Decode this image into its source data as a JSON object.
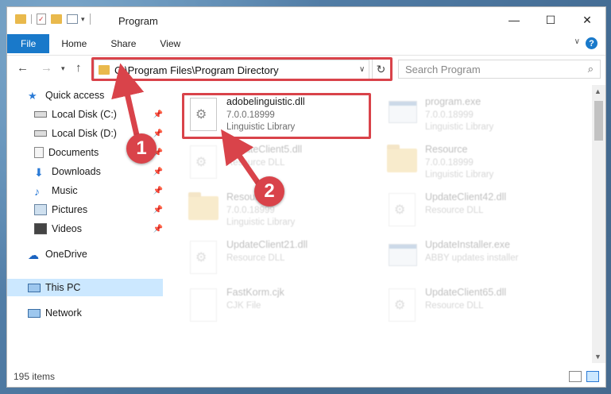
{
  "window": {
    "title": "Program",
    "minimize_glyph": "—",
    "maximize_glyph": "☐",
    "close_glyph": "✕"
  },
  "ribbon": {
    "tabs": [
      "File",
      "Home",
      "Share",
      "View"
    ],
    "help_glyph": "?"
  },
  "address": {
    "path": "C:\\Program Files\\Program Directory",
    "search_placeholder": "Search Program"
  },
  "nav": {
    "items": [
      {
        "label": "Quick access",
        "icon": "star-icon",
        "pinned": false
      },
      {
        "label": "Local Disk (C:)",
        "icon": "drive-icon",
        "pinned": true
      },
      {
        "label": "Local Disk (D:)",
        "icon": "drive-icon",
        "pinned": true
      },
      {
        "label": "Documents",
        "icon": "documents-icon",
        "pinned": true
      },
      {
        "label": "Downloads",
        "icon": "download-icon",
        "pinned": true
      },
      {
        "label": "Music",
        "icon": "music-icon",
        "pinned": true
      },
      {
        "label": "Pictures",
        "icon": "pictures-icon",
        "pinned": true
      },
      {
        "label": "Videos",
        "icon": "videos-icon",
        "pinned": true
      },
      {
        "label": "OneDrive",
        "icon": "cloud-icon",
        "pinned": false
      },
      {
        "label": "This PC",
        "icon": "computer-icon",
        "pinned": false
      },
      {
        "label": "Network",
        "icon": "network-icon",
        "pinned": false
      }
    ]
  },
  "files": [
    {
      "name": "adobelinguistic.dll",
      "meta1": "7.0.0.18999",
      "meta2": "Linguistic Library",
      "icon": "dll-file-icon"
    },
    {
      "name": "program.exe",
      "meta1": "7.0.0.18999",
      "meta2": "Linguistic Library",
      "icon": "exe-file-icon"
    },
    {
      "name": "UpdateClient5.dll",
      "meta1": "Resource DLL",
      "meta2": "",
      "icon": "dll-file-icon"
    },
    {
      "name": "Resource",
      "meta1": "7.0.0.18999",
      "meta2": "Linguistic Library",
      "icon": "folder-icon"
    },
    {
      "name": "Resource",
      "meta1": "7.0.0.18999",
      "meta2": "Linguistic Library",
      "icon": "folder-icon"
    },
    {
      "name": "UpdateClient42.dll",
      "meta1": "Resource DLL",
      "meta2": "",
      "icon": "dll-file-icon"
    },
    {
      "name": "UpdateClient21.dll",
      "meta1": "Resource DLL",
      "meta2": "",
      "icon": "dll-file-icon"
    },
    {
      "name": "UpdateInstaller.exe",
      "meta1": "ABBY updates installer",
      "meta2": "",
      "icon": "app-icon"
    },
    {
      "name": "FastKorm.cjk",
      "meta1": "CJK File",
      "meta2": "",
      "icon": "file-icon"
    },
    {
      "name": "UpdateClient65.dll",
      "meta1": "Resource DLL",
      "meta2": "",
      "icon": "dll-file-icon"
    }
  ],
  "status": {
    "item_count": "195 items"
  },
  "annotations": {
    "step1": "1",
    "step2": "2",
    "color": "#d9434a"
  }
}
